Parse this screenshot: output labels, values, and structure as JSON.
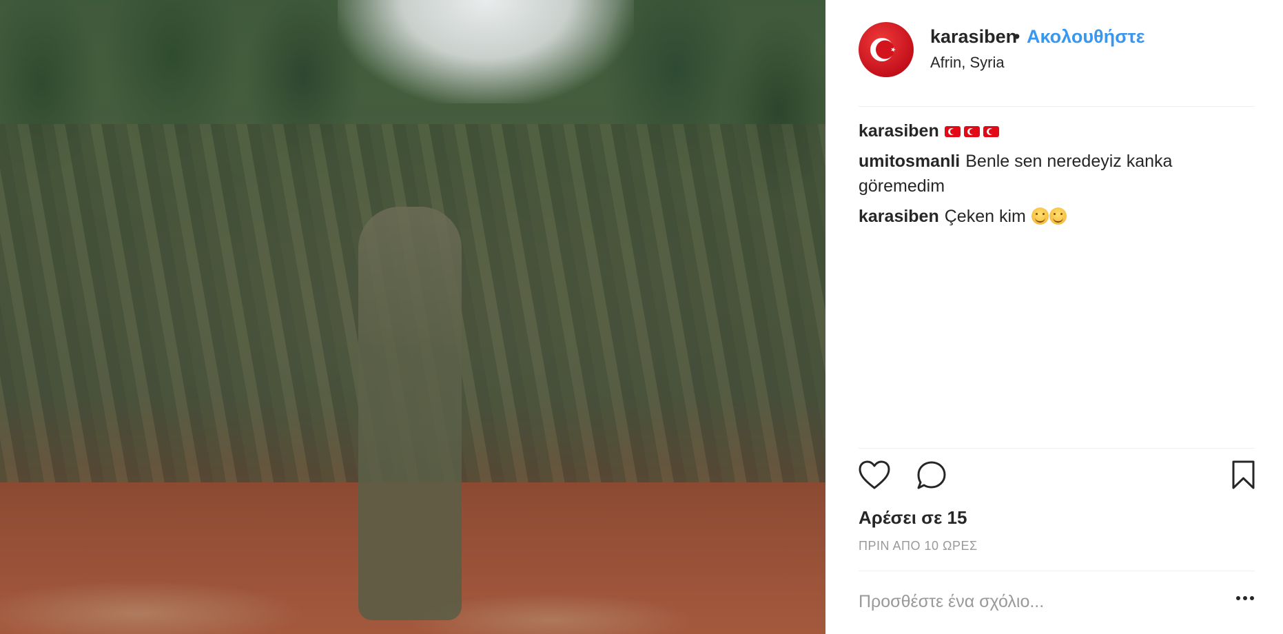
{
  "post": {
    "username": "karasiben",
    "separator": "•",
    "follow_label": "Ακολουθήστε",
    "location": "Afrin, Syria"
  },
  "comments": [
    {
      "user": "karasiben",
      "text": "",
      "emoji": [
        "turkey-flag",
        "turkey-flag",
        "turkey-flag"
      ]
    },
    {
      "user": "umitosmanli",
      "text": "Benle sen neredeyiz kanka göremedim"
    },
    {
      "user": "karasiben",
      "text": "Çeken kim",
      "emoji": [
        "smiling-face",
        "smiling-face"
      ]
    }
  ],
  "actions": {
    "likes": "Αρέσει σε 15",
    "time": "ΠΡΙΝ ΑΠΟ 10 ΩΡΕΣ"
  },
  "add_comment": {
    "placeholder": "Προσθέστε ένα σχόλιο...",
    "more_label": "..."
  },
  "colors": {
    "link": "#3897f0",
    "text": "#262626",
    "muted": "#999999",
    "avatar_red": "#e30a17"
  },
  "icons": [
    "heart-icon",
    "comment-icon",
    "bookmark-icon",
    "more-options-icon"
  ]
}
